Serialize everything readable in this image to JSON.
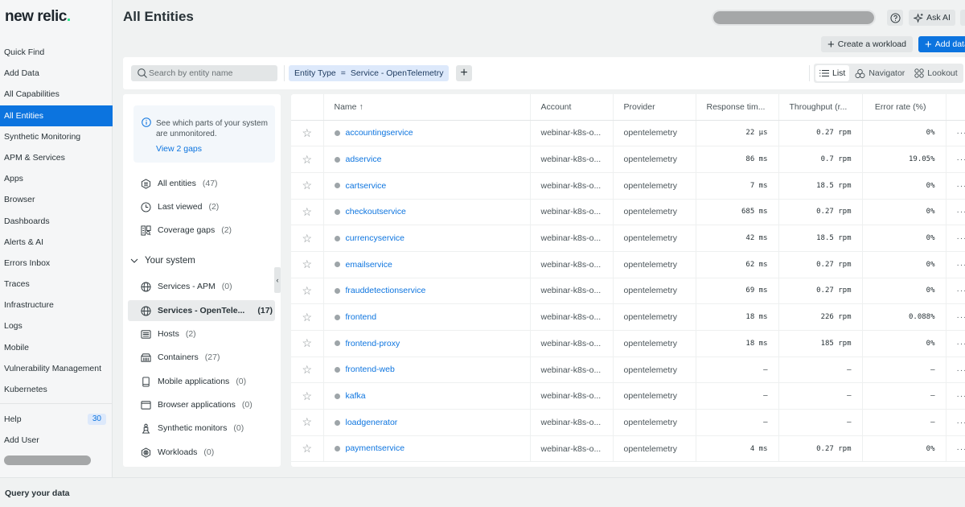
{
  "app": {
    "logo": "new relic",
    "logo_dot": "."
  },
  "nav": {
    "items": [
      {
        "label": "Quick Find"
      },
      {
        "label": "Add Data"
      },
      {
        "label": "All Capabilities"
      },
      {
        "label": "All Entities",
        "active": true
      },
      {
        "label": "Synthetic Monitoring"
      },
      {
        "label": "APM & Services"
      },
      {
        "label": "Apps"
      },
      {
        "label": "Browser"
      },
      {
        "label": "Dashboards"
      },
      {
        "label": "Alerts & AI"
      },
      {
        "label": "Errors Inbox"
      },
      {
        "label": "Traces"
      },
      {
        "label": "Infrastructure"
      },
      {
        "label": "Logs"
      },
      {
        "label": "Mobile"
      },
      {
        "label": "Vulnerability Management"
      },
      {
        "label": "Kubernetes"
      }
    ],
    "help_label": "Help",
    "help_badge": "30",
    "add_user_label": "Add User"
  },
  "bottom_bar": {
    "label": "Query your data"
  },
  "header": {
    "title": "All Entities",
    "ask_ai_label": "Ask AI",
    "create_workload_label": "Create a workload",
    "add_data_label": "Add data"
  },
  "filter_bar": {
    "search_placeholder": "Search by entity name",
    "search_value": "",
    "chip_field": "Entity Type",
    "chip_operator": "=",
    "chip_value": "Service - OpenTelemetry",
    "views": [
      {
        "label": "List",
        "active": true
      },
      {
        "label": "Navigator"
      },
      {
        "label": "Lookout"
      }
    ]
  },
  "left_panel": {
    "gap_text": "See which parts of your system are unmonitored.",
    "gap_link": "View 2 gaps",
    "quick": [
      {
        "label": "All entities",
        "count": "(47)"
      },
      {
        "label": "Last viewed",
        "count": "(2)"
      },
      {
        "label": "Coverage gaps",
        "count": "(2)"
      }
    ],
    "section_title": "Your system",
    "system": [
      {
        "label": "Services - APM",
        "count": "(0)"
      },
      {
        "label": "Services - OpenTele...",
        "count": "(17)",
        "selected": true
      },
      {
        "label": "Hosts",
        "count": "(2)"
      },
      {
        "label": "Containers",
        "count": "(27)"
      },
      {
        "label": "Mobile applications",
        "count": "(0)"
      },
      {
        "label": "Browser applications",
        "count": "(0)"
      },
      {
        "label": "Synthetic monitors",
        "count": "(0)"
      },
      {
        "label": "Workloads",
        "count": "(0)"
      }
    ]
  },
  "table": {
    "columns": {
      "name": "Name",
      "name_sort": "↑",
      "account": "Account",
      "provider": "Provider",
      "response": "Response tim...",
      "throughput": "Throughput (r...",
      "error": "Error rate (%)"
    },
    "rows": [
      {
        "name": "accountingservice",
        "account": "webinar-k8s-o...",
        "provider": "opentelemetry",
        "response": "22 µs",
        "throughput": "0.27 rpm",
        "error": "0%"
      },
      {
        "name": "adservice",
        "account": "webinar-k8s-o...",
        "provider": "opentelemetry",
        "response": "86 ms",
        "throughput": "0.7 rpm",
        "error": "19.05%"
      },
      {
        "name": "cartservice",
        "account": "webinar-k8s-o...",
        "provider": "opentelemetry",
        "response": "7 ms",
        "throughput": "18.5 rpm",
        "error": "0%"
      },
      {
        "name": "checkoutservice",
        "account": "webinar-k8s-o...",
        "provider": "opentelemetry",
        "response": "685 ms",
        "throughput": "0.27 rpm",
        "error": "0%"
      },
      {
        "name": "currencyservice",
        "account": "webinar-k8s-o...",
        "provider": "opentelemetry",
        "response": "42 ms",
        "throughput": "18.5 rpm",
        "error": "0%"
      },
      {
        "name": "emailservice",
        "account": "webinar-k8s-o...",
        "provider": "opentelemetry",
        "response": "62 ms",
        "throughput": "0.27 rpm",
        "error": "0%"
      },
      {
        "name": "frauddetectionservice",
        "account": "webinar-k8s-o...",
        "provider": "opentelemetry",
        "response": "69 ms",
        "throughput": "0.27 rpm",
        "error": "0%"
      },
      {
        "name": "frontend",
        "account": "webinar-k8s-o...",
        "provider": "opentelemetry",
        "response": "18 ms",
        "throughput": "226 rpm",
        "error": "0.088%"
      },
      {
        "name": "frontend-proxy",
        "account": "webinar-k8s-o...",
        "provider": "opentelemetry",
        "response": "18 ms",
        "throughput": "185 rpm",
        "error": "0%"
      },
      {
        "name": "frontend-web",
        "account": "webinar-k8s-o...",
        "provider": "opentelemetry",
        "response": "–",
        "throughput": "–",
        "error": "–"
      },
      {
        "name": "kafka",
        "account": "webinar-k8s-o...",
        "provider": "opentelemetry",
        "response": "–",
        "throughput": "–",
        "error": "–"
      },
      {
        "name": "loadgenerator",
        "account": "webinar-k8s-o...",
        "provider": "opentelemetry",
        "response": "–",
        "throughput": "–",
        "error": "–"
      },
      {
        "name": "paymentservice",
        "account": "webinar-k8s-o...",
        "provider": "opentelemetry",
        "response": "4 ms",
        "throughput": "0.27 rpm",
        "error": "0%"
      }
    ],
    "more_label": "···"
  },
  "colors": {
    "accent": "#0c74df",
    "chip_bg": "#dde9fb",
    "status_dot": "#9ea5a9"
  }
}
